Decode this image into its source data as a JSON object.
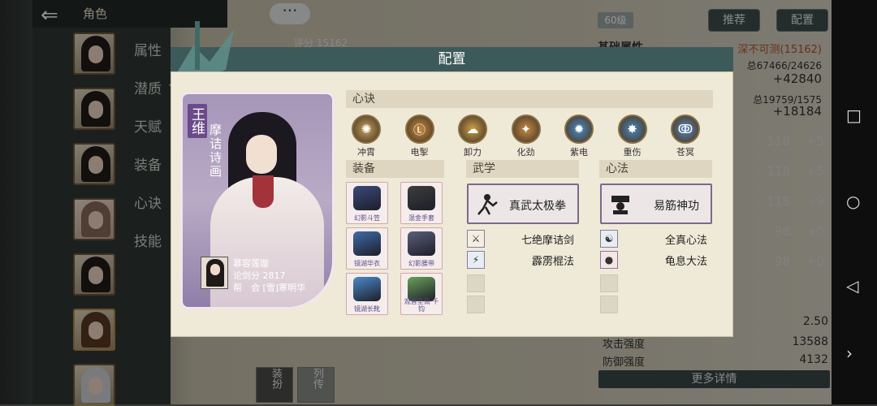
{
  "topbar": {
    "title": "角色"
  },
  "nav_tabs": [
    "属性",
    "潜质",
    "天赋",
    "装备",
    "心诀",
    "技能"
  ],
  "level": "60级",
  "score": "评分 15162",
  "buttons": {
    "recommend": "推荐",
    "config": "配置"
  },
  "right_stats": {
    "base_label": "基础属性",
    "rating": "深不可测(15162)",
    "total1": "总67466/24626",
    "total1_add": "+42840",
    "total2": "总19759/1575",
    "total2_add": "+18184",
    "rows": [
      {
        "val": "118",
        "add": "+5"
      },
      {
        "val": "118",
        "add": "+5"
      },
      {
        "val": "118",
        "add": "+9"
      },
      {
        "val": "98",
        "add": "+0"
      },
      {
        "val": "98",
        "add": "+0"
      }
    ],
    "v250": "2.50",
    "atk_label": "攻击强度",
    "atk_val": "13588",
    "def_label": "防御强度",
    "def_val": "4132",
    "more": "更多详情"
  },
  "bottom_tabs": {
    "equip": "装扮",
    "bio": "列传"
  },
  "modal": {
    "title": "配置",
    "character": {
      "name": "王维",
      "title": "摩诘诗画",
      "owner_name": "慕容莲璇",
      "owner_score": "论剑分 2817",
      "owner_guild": "帮　会 [雪]寒明华"
    },
    "xinjue_header": "心诀",
    "xinjue": [
      {
        "label": "冲霄",
        "color": "#c9a15a"
      },
      {
        "label": "电掣",
        "color": "#c98a3a"
      },
      {
        "label": "卸力",
        "color": "#d0a048"
      },
      {
        "label": "化劲",
        "color": "#c88b45"
      },
      {
        "label": "紫电",
        "color": "#4a8ac4"
      },
      {
        "label": "重伤",
        "color": "#4a86bc"
      },
      {
        "label": "苍冥",
        "color": "#5b86b8"
      }
    ],
    "equip_header": "装备",
    "equip": [
      {
        "label": "幻影斗笠",
        "color": "#3b4a7a"
      },
      {
        "label": "混金手套",
        "color": "#3a3f3a"
      },
      {
        "label": "镜湖华衣",
        "color": "#3f6ca8"
      },
      {
        "label": "幻影腰带",
        "color": "#5a5f7a"
      },
      {
        "label": "镜湖长靴",
        "color": "#4a8ac8"
      },
      {
        "label": "观音坠佩·千钧",
        "color": "#6aa05a"
      }
    ],
    "wuxue_header": "武学",
    "wuxue_main": "真武太极拳",
    "wuxue": [
      "七绝摩诘剑",
      "霹雳棍法"
    ],
    "xinfa_header": "心法",
    "xinfa_main": "易筋神功",
    "xinfa": [
      "全真心法",
      "龟息大法"
    ]
  }
}
